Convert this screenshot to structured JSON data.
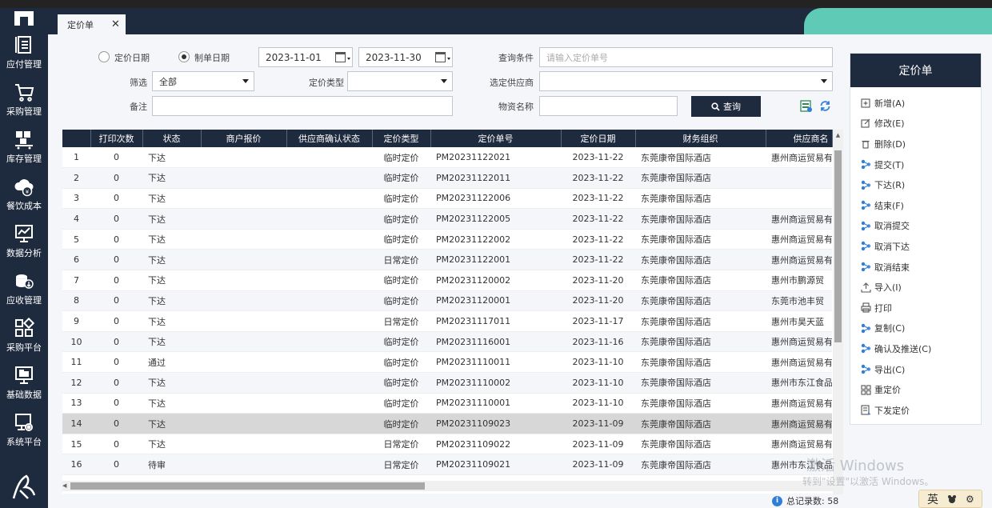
{
  "sidebar": {
    "items": [
      {
        "label": "应付管理",
        "icon": "upload-list-icon"
      },
      {
        "label": "采购管理",
        "icon": "cart-icon"
      },
      {
        "label": "库存管理",
        "icon": "warehouse-cart-icon"
      },
      {
        "label": "餐饮成本",
        "icon": "cloud-yen-icon"
      },
      {
        "label": "数据分析",
        "icon": "chart-monitor-icon"
      },
      {
        "label": "应收管理",
        "icon": "coins-icon"
      },
      {
        "label": "采购平台",
        "icon": "grid-icon"
      },
      {
        "label": "基础数据",
        "icon": "monitor-icon"
      },
      {
        "label": "系统平台",
        "icon": "settings-monitor-icon"
      }
    ]
  },
  "tab": {
    "label": "定价单",
    "close": "✕"
  },
  "filters": {
    "radio_pricing_date": "定价日期",
    "radio_create_date": "制单日期",
    "date_from": "2023-11-01",
    "date_to": "2023-11-30",
    "query_cond_label": "查询条件",
    "query_cond_placeholder": "请输入定价单号",
    "filter_label": "筛选",
    "filter_value": "全部",
    "pricing_type_label": "定价类型",
    "supplier_label": "选定供应商",
    "remark_label": "备注",
    "material_label": "物资名称",
    "query_button": "查询"
  },
  "table": {
    "columns": [
      "",
      "打印次数",
      "状态",
      "商户报价",
      "供应商确认状态",
      "定价类型",
      "定价单号",
      "定价日期",
      "财务组织",
      "供应商名"
    ],
    "rows": [
      [
        "1",
        "0",
        "下达",
        "",
        "",
        "临时定价",
        "PM20231122021",
        "2023-11-22",
        "东莞康帝国际酒店",
        "惠州商运贸易有"
      ],
      [
        "2",
        "0",
        "下达",
        "",
        "",
        "临时定价",
        "PM20231122011",
        "2023-11-22",
        "东莞康帝国际酒店",
        ""
      ],
      [
        "3",
        "0",
        "下达",
        "",
        "",
        "临时定价",
        "PM20231122006",
        "2023-11-22",
        "东莞康帝国际酒店",
        ""
      ],
      [
        "4",
        "0",
        "下达",
        "",
        "",
        "临时定价",
        "PM20231122005",
        "2023-11-22",
        "东莞康帝国际酒店",
        "惠州商运贸易有"
      ],
      [
        "5",
        "0",
        "下达",
        "",
        "",
        "临时定价",
        "PM20231122002",
        "2023-11-22",
        "东莞康帝国际酒店",
        "惠州商运贸易有"
      ],
      [
        "6",
        "0",
        "下达",
        "",
        "",
        "日常定价",
        "PM20231122001",
        "2023-11-22",
        "东莞康帝国际酒店",
        "惠州商运贸易有"
      ],
      [
        "7",
        "0",
        "下达",
        "",
        "",
        "临时定价",
        "PM20231120002",
        "2023-11-20",
        "东莞康帝国际酒店",
        "惠州市鹏源贸"
      ],
      [
        "8",
        "0",
        "下达",
        "",
        "",
        "临时定价",
        "PM20231120001",
        "2023-11-20",
        "东莞康帝国际酒店",
        "东莞市池丰贸"
      ],
      [
        "9",
        "0",
        "下达",
        "",
        "",
        "日常定价",
        "PM20231117011",
        "2023-11-17",
        "东莞康帝国际酒店",
        "惠州市昊天蓝"
      ],
      [
        "10",
        "0",
        "下达",
        "",
        "",
        "临时定价",
        "PM20231116001",
        "2023-11-16",
        "东莞康帝国际酒店",
        "惠州商运贸易有"
      ],
      [
        "11",
        "0",
        "通过",
        "",
        "",
        "临时定价",
        "PM20231110011",
        "2023-11-10",
        "东莞康帝国际酒店",
        "惠州商运贸易有"
      ],
      [
        "12",
        "0",
        "下达",
        "",
        "",
        "临时定价",
        "PM20231110002",
        "2023-11-10",
        "东莞康帝国际酒店",
        "惠州市东江食品"
      ],
      [
        "13",
        "0",
        "下达",
        "",
        "",
        "临时定价",
        "PM20231110001",
        "2023-11-10",
        "东莞康帝国际酒店",
        "惠州商运贸易有"
      ],
      [
        "14",
        "0",
        "下达",
        "",
        "",
        "临时定价",
        "PM20231109023",
        "2023-11-09",
        "东莞康帝国际酒店",
        "惠州商运贸易有"
      ],
      [
        "15",
        "0",
        "下达",
        "",
        "",
        "日常定价",
        "PM20231109022",
        "2023-11-09",
        "东莞康帝国际酒店",
        "惠州商运贸易有"
      ],
      [
        "16",
        "0",
        "待审",
        "",
        "",
        "日常定价",
        "PM20231109021",
        "2023-11-09",
        "东莞康帝国际酒店",
        "惠州市东江食品"
      ]
    ],
    "selected_row": 14
  },
  "status": {
    "total_label": "总记录数: 58"
  },
  "panel": {
    "title": "定价单",
    "actions": [
      {
        "label": "新增(A)",
        "icon": "plus-square-icon"
      },
      {
        "label": "修改(E)",
        "icon": "edit-icon"
      },
      {
        "label": "删除(D)",
        "icon": "trash-icon"
      },
      {
        "label": "提交(T)",
        "icon": "workflow-icon"
      },
      {
        "label": "下达(R)",
        "icon": "workflow-icon"
      },
      {
        "label": "结束(F)",
        "icon": "workflow-icon"
      },
      {
        "label": "取消提交",
        "icon": "workflow-icon"
      },
      {
        "label": "取消下达",
        "icon": "workflow-icon"
      },
      {
        "label": "取消结束",
        "icon": "workflow-icon"
      },
      {
        "label": "导入(I)",
        "icon": "import-icon"
      },
      {
        "label": "打印",
        "icon": "printer-icon"
      },
      {
        "label": "复制(C)",
        "icon": "workflow-icon"
      },
      {
        "label": "确认及推送(C)",
        "icon": "workflow-icon"
      },
      {
        "label": "导出(C)",
        "icon": "workflow-icon"
      },
      {
        "label": "重定价",
        "icon": "grid-reset-icon"
      },
      {
        "label": "下发定价",
        "icon": "document-send-icon"
      }
    ]
  },
  "watermark": {
    "line1": "激活 Windows",
    "line2": "转到\"设置\"以激活 Windows。"
  },
  "ime": {
    "label": "英"
  },
  "colors": {
    "navy": "#1e2a3d",
    "teal": "#5fcab5",
    "content_bg": "#f4f6f9",
    "accent_blue": "#2f7fd8"
  }
}
